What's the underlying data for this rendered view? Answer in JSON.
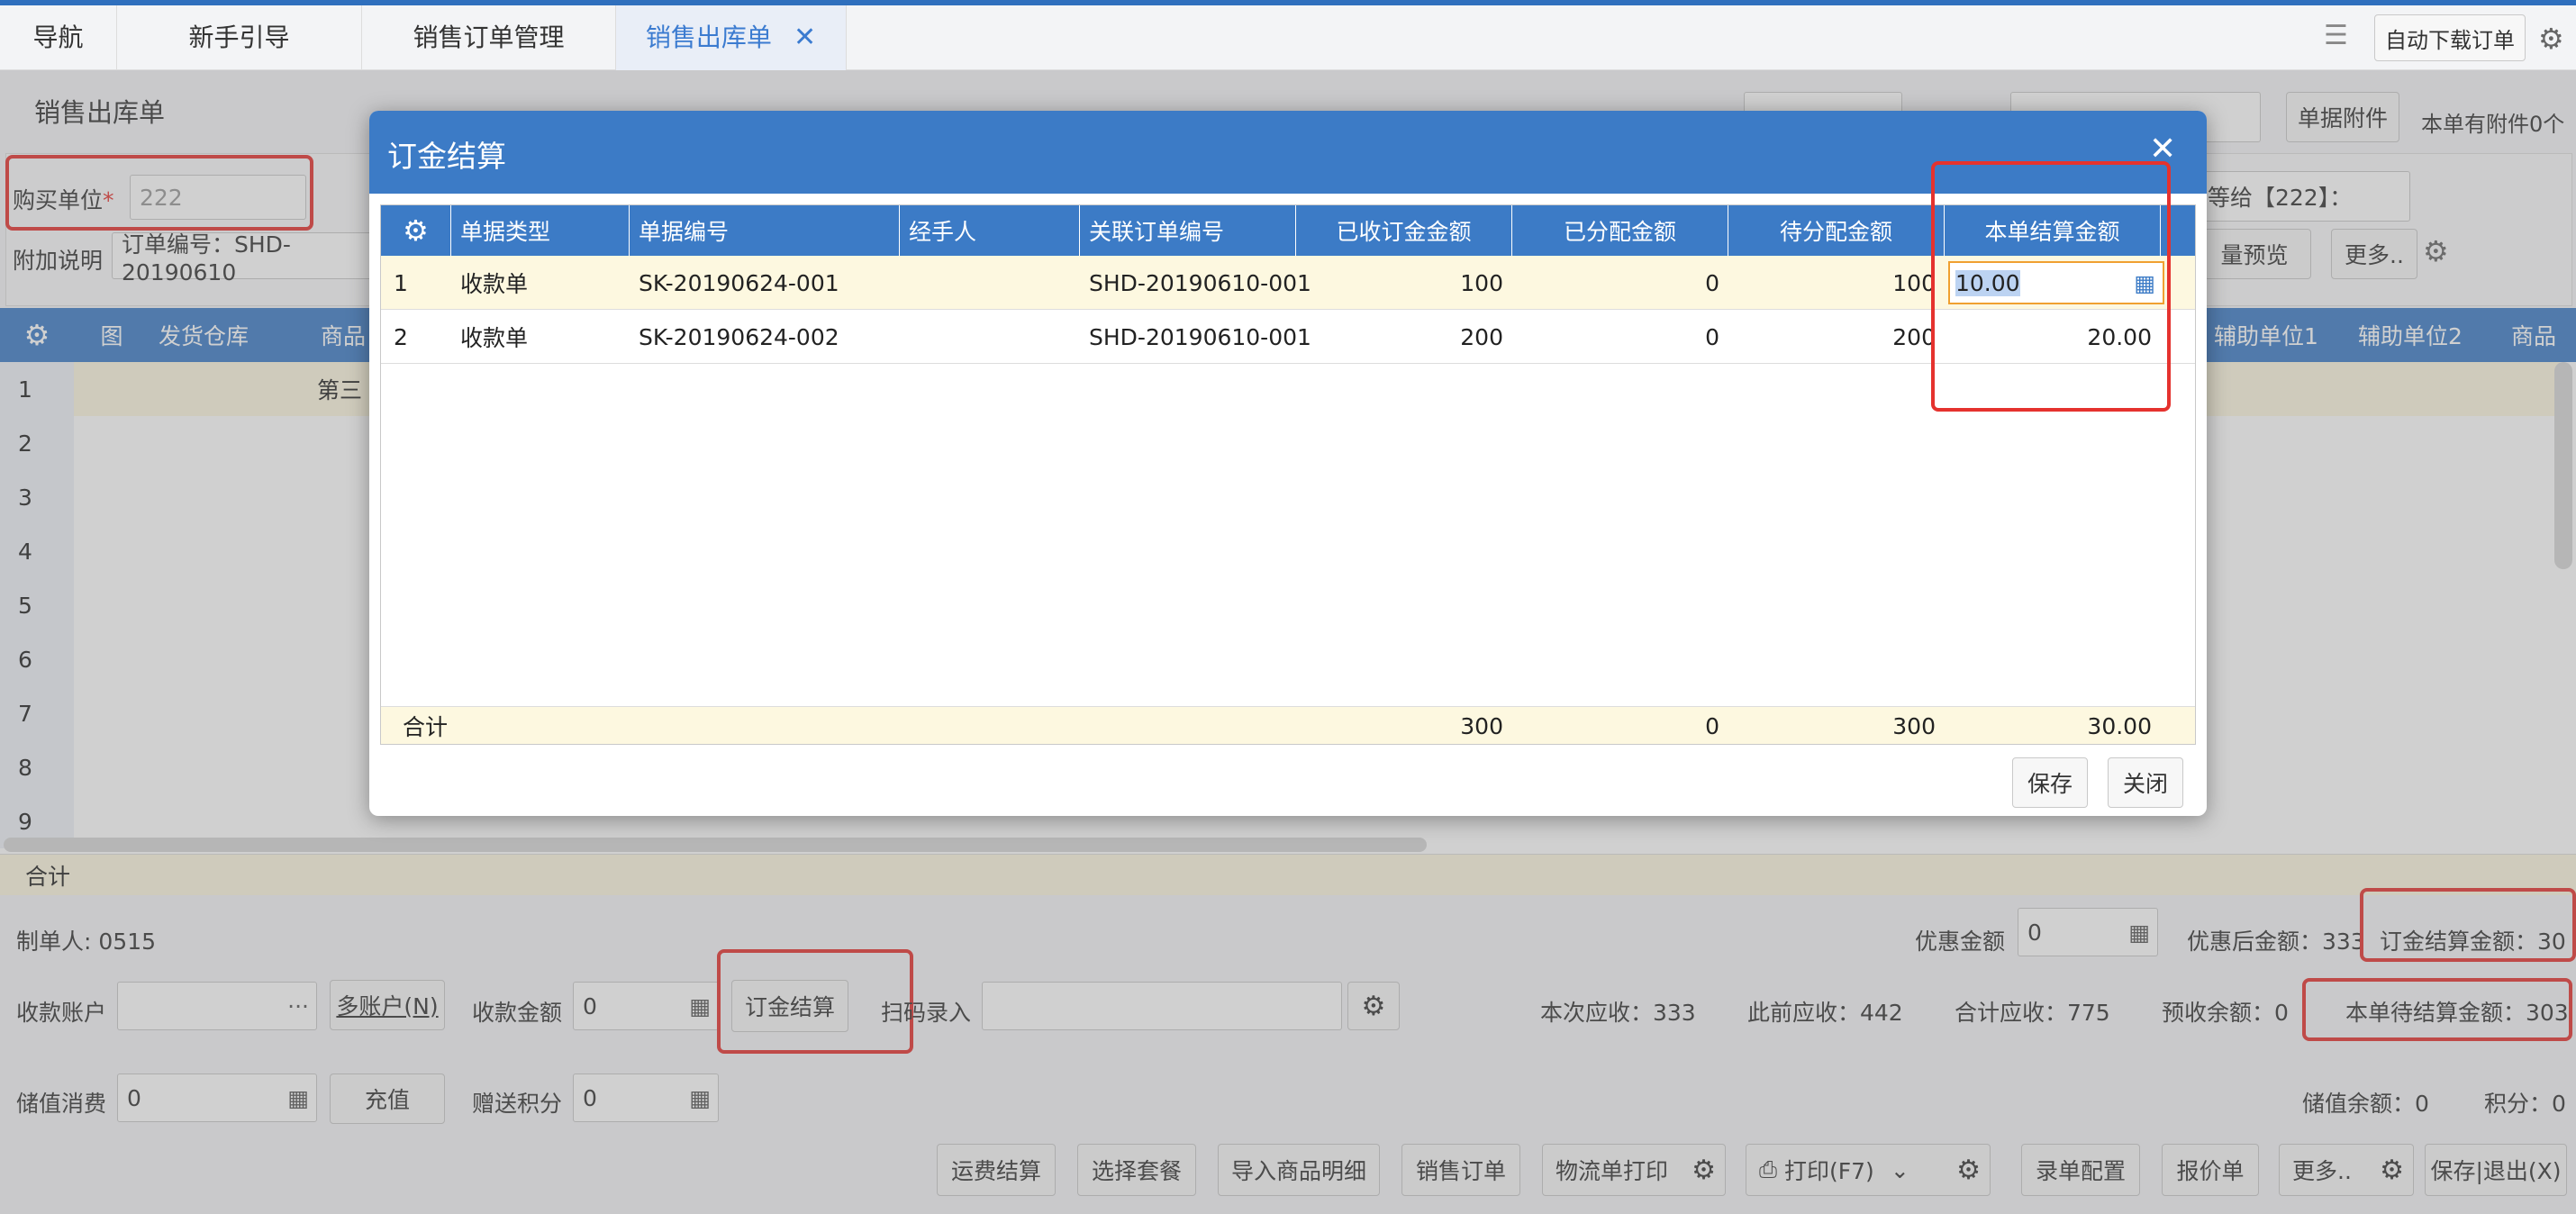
{
  "tabs": [
    {
      "label": "导航"
    },
    {
      "label": "新手引导"
    },
    {
      "label": "销售订单管理"
    },
    {
      "label": "销售出库单",
      "active": true
    }
  ],
  "topright": {
    "auto_download": "自动下载订单"
  },
  "page": {
    "title": "销售出库单",
    "attach_btn": "单据附件",
    "attach_info": "本单有附件0个",
    "buyer_label": "购买单位",
    "buyer_required": "*",
    "buyer_value": "222",
    "remark_label": "附加说明",
    "remark_value": "订单编号：SHD-20190610",
    "give_label": "等给【222】：",
    "preview_btn": "量预览",
    "more_btn": "更多.."
  },
  "grid": {
    "headers": [
      "图",
      "发货仓库",
      "商品",
      "辅助单位1",
      "辅助单位2",
      "商品"
    ],
    "row_numbers": [
      "1",
      "2",
      "3",
      "4",
      "5",
      "6",
      "7",
      "8",
      "9"
    ],
    "row1_text": "第三",
    "total_label": "合计"
  },
  "footer": {
    "creator_label": "制单人:",
    "creator_value": "0515",
    "discount_label": "优惠金额",
    "discount_value": "0",
    "after_discount": "优惠后金额：333",
    "deposit_settle_amt": "订金结算金额：30",
    "account_label": "收款账户",
    "multi_account_btn": "多账户(N)",
    "collect_label": "收款金额",
    "collect_value": "0",
    "deposit_settle_btn": "订金结算",
    "scan_label": "扫码录入",
    "this_receivable": "本次应收：333",
    "prev_receivable": "此前应收：442",
    "total_receivable": "合计应收：775",
    "prepaid_balance": "预收余额：0",
    "pending_settle": "本单待结算金额：303",
    "stored_label": "储值消费",
    "stored_value": "0",
    "recharge_btn": "充值",
    "points_label": "赠送积分",
    "points_value": "0",
    "stored_balance": "储值余额：0",
    "points_balance": "积分：0"
  },
  "bottom_buttons": {
    "freight": "运费结算",
    "package": "选择套餐",
    "import": "导入商品明细",
    "sales_order": "销售订单",
    "logistics_print": "物流单打印",
    "print": "打印(F7)",
    "entry_config": "录单配置",
    "quote": "报价单",
    "more": "更多..",
    "save_exit": "保存|退出(X)"
  },
  "modal": {
    "title": "订金结算",
    "headers": [
      "单据类型",
      "单据编号",
      "经手人",
      "关联订单编号",
      "已收订金金额",
      "已分配金额",
      "待分配金额",
      "本单结算金额"
    ],
    "rows": [
      {
        "no": "1",
        "type": "收款单",
        "code": "SK-20190624-001",
        "handler": "",
        "order": "SHD-20190610-001",
        "received": "100",
        "allocated": "0",
        "pending": "100",
        "settle": "10.00"
      },
      {
        "no": "2",
        "type": "收款单",
        "code": "SK-20190624-002",
        "handler": "",
        "order": "SHD-20190610-001",
        "received": "200",
        "allocated": "0",
        "pending": "200",
        "settle": "20.00"
      }
    ],
    "total": {
      "label": "合计",
      "received": "300",
      "allocated": "0",
      "pending": "300",
      "settle": "30.00"
    },
    "save_btn": "保存",
    "close_btn": "关闭"
  },
  "colors": {
    "header_blue": "#3c7bc6",
    "highlight_red": "#e5322e",
    "row_yellow": "#fdf8e0"
  }
}
